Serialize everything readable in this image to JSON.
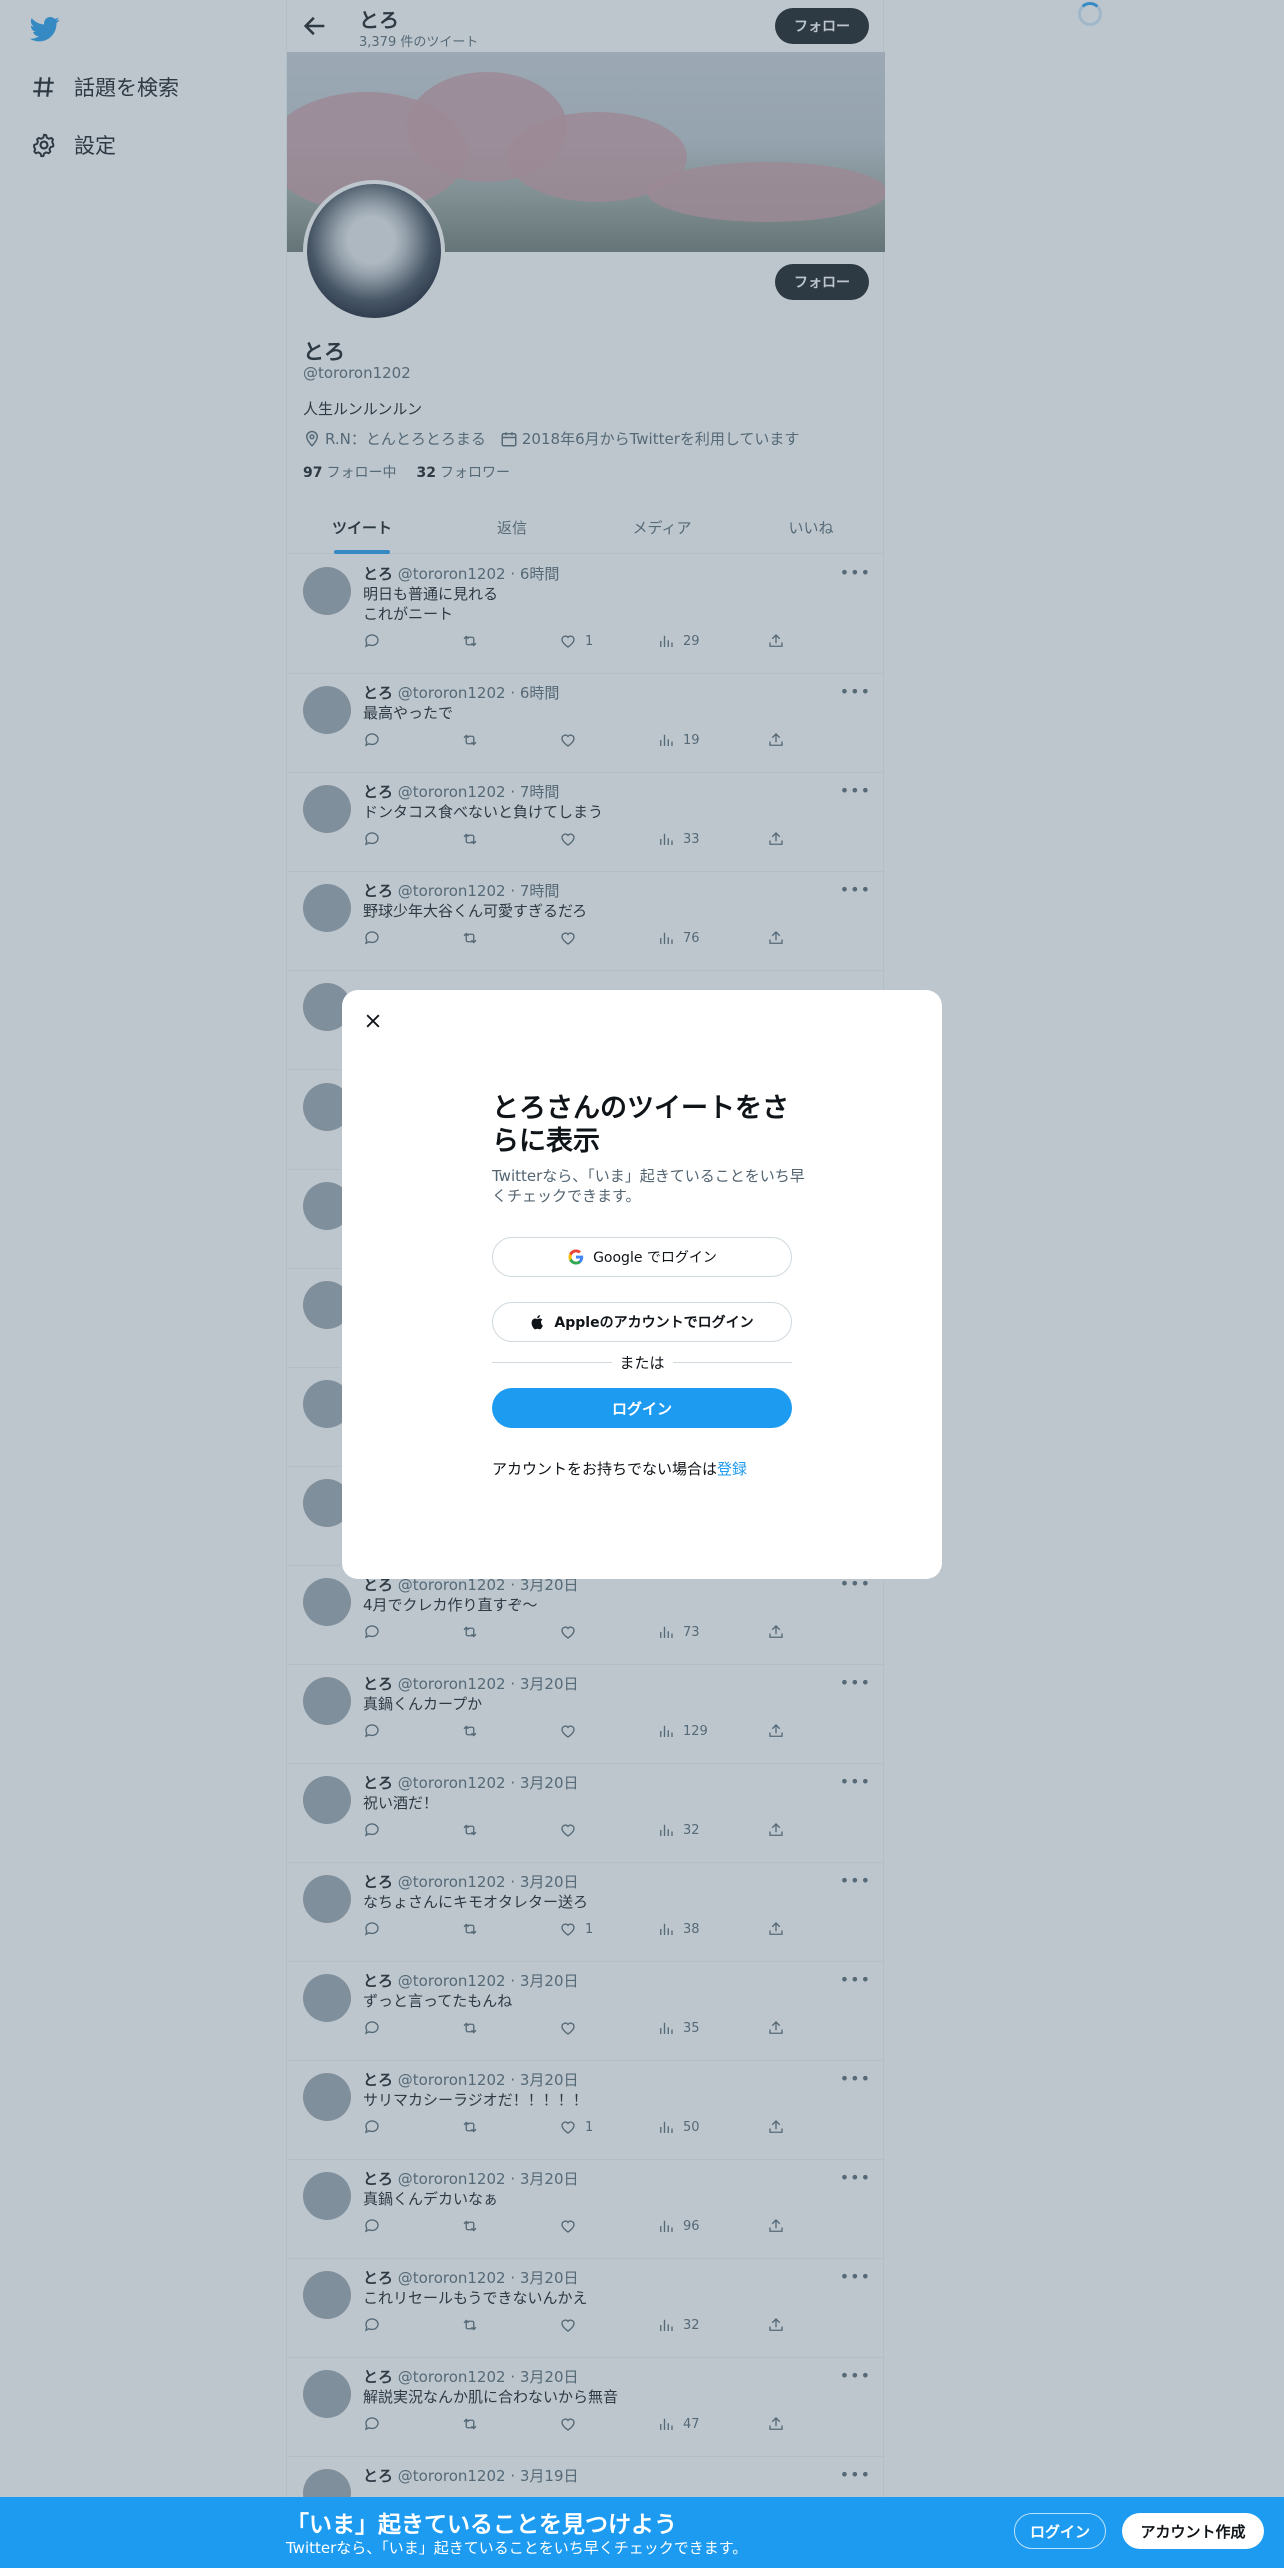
{
  "nav": {
    "explore_label": "話題を検索",
    "settings_label": "設定"
  },
  "colors": {
    "accent": "#1d9bf0",
    "text": "#0f1419",
    "muted": "#536471"
  },
  "header": {
    "name": "とろ",
    "tweet_count": "3,379 件のツイート",
    "follow_label": "フォロー"
  },
  "profile": {
    "name": "とろ",
    "handle": "@tororon1202",
    "bio": "人生ルンルンルン",
    "location": "R.N：とんとろとろまる",
    "joined": "2018年6月からTwitterを利用しています",
    "following_count": "97",
    "following_label": "フォロー中",
    "followers_count": "32",
    "followers_label": "フォロワー",
    "follow_label": "フォロー"
  },
  "tabs": [
    "ツイート",
    "返信",
    "メディア",
    "いいね"
  ],
  "tweets": [
    {
      "name": "とろ",
      "meta": "@tororon1202 · 6時間",
      "text": "明日も普通に見れる\nこれがニート",
      "likes": "1",
      "views": "29"
    },
    {
      "name": "とろ",
      "meta": "@tororon1202 · 6時間",
      "text": "最高やったで",
      "likes": "",
      "views": "19"
    },
    {
      "name": "とろ",
      "meta": "@tororon1202 · 7時間",
      "text": "ドンタコス食べないと負けてしまう",
      "likes": "",
      "views": "33"
    },
    {
      "name": "とろ",
      "meta": "@tororon1202 · 7時間",
      "text": "野球少年大谷くん可愛すぎるだろ",
      "likes": "",
      "views": "76"
    },
    {
      "name": "とろ",
      "meta": "@tororon1202 · 3月20日",
      "text": "4月でクレカ作り直すぞ〜",
      "likes": "",
      "views": "73"
    },
    {
      "name": "とろ",
      "meta": "@tororon1202 · 3月20日",
      "text": "真鍋くんカープか",
      "likes": "",
      "views": "129"
    },
    {
      "name": "とろ",
      "meta": "@tororon1202 · 3月20日",
      "text": "祝い酒だ！",
      "likes": "",
      "views": "32"
    },
    {
      "name": "とろ",
      "meta": "@tororon1202 · 3月20日",
      "text": "なちょさんにキモオタレター送ろ",
      "likes": "1",
      "views": "38"
    },
    {
      "name": "とろ",
      "meta": "@tororon1202 · 3月20日",
      "text": "ずっと言ってたもんね",
      "likes": "",
      "views": "35"
    },
    {
      "name": "とろ",
      "meta": "@tororon1202 · 3月20日",
      "text": "サリマカシーラジオだ！！！！！",
      "likes": "1",
      "views": "50"
    },
    {
      "name": "とろ",
      "meta": "@tororon1202 · 3月20日",
      "text": "真鍋くんデカいなぁ",
      "likes": "",
      "views": "96"
    },
    {
      "name": "とろ",
      "meta": "@tororon1202 · 3月20日",
      "text": "これリセールもうできないんかえ",
      "likes": "",
      "views": "32"
    },
    {
      "name": "とろ",
      "meta": "@tororon1202 · 3月20日",
      "text": "解説実況なんか肌に合わないから無音",
      "likes": "",
      "views": "47"
    },
    {
      "name": "とろ",
      "meta": "@tororon1202 · 3月19日",
      "text": "",
      "likes": "",
      "views": ""
    }
  ],
  "modal": {
    "title": "とろさんのツイートをさらに表示",
    "subtitle": "Twitterなら、「いま」起きていることをいち早くチェックできます。",
    "google_label": "Google でログイン",
    "apple_label": "Appleのアカウントでログイン",
    "or_label": "または",
    "login_label": "ログイン",
    "signup_text": "アカウントをお持ちでない場合は",
    "signup_link": "登録"
  },
  "bottom_bar": {
    "title": "「いま」起きていることを見つけよう",
    "subtitle": "Twitterなら、「いま」起きていることをいち早くチェックできます。",
    "login_label": "ログイン",
    "signup_label": "アカウント作成"
  }
}
